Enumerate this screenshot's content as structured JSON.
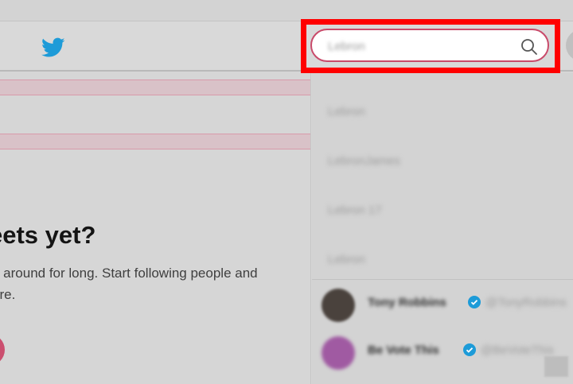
{
  "header": {
    "logo_icon": "twitter-bird-icon",
    "brand_color": "#1da1f2"
  },
  "search": {
    "value": "Lebron",
    "icon": "search-icon",
    "highlight_color": "#ff0000"
  },
  "timeline": {
    "headline": "eets yet?",
    "sub_line1": "e around for long. Start following people and",
    "sub_line2": "ere."
  },
  "dropdown": {
    "suggestions": [
      "Lebron",
      "LebronJames",
      "Lebron 17",
      "Lebron"
    ],
    "people": [
      {
        "name": "Tony Robbins",
        "handle": "@TonyRobbins",
        "verified": true
      },
      {
        "name": "Be Vote This",
        "handle": "@BeVoteThis",
        "verified": true
      }
    ]
  }
}
